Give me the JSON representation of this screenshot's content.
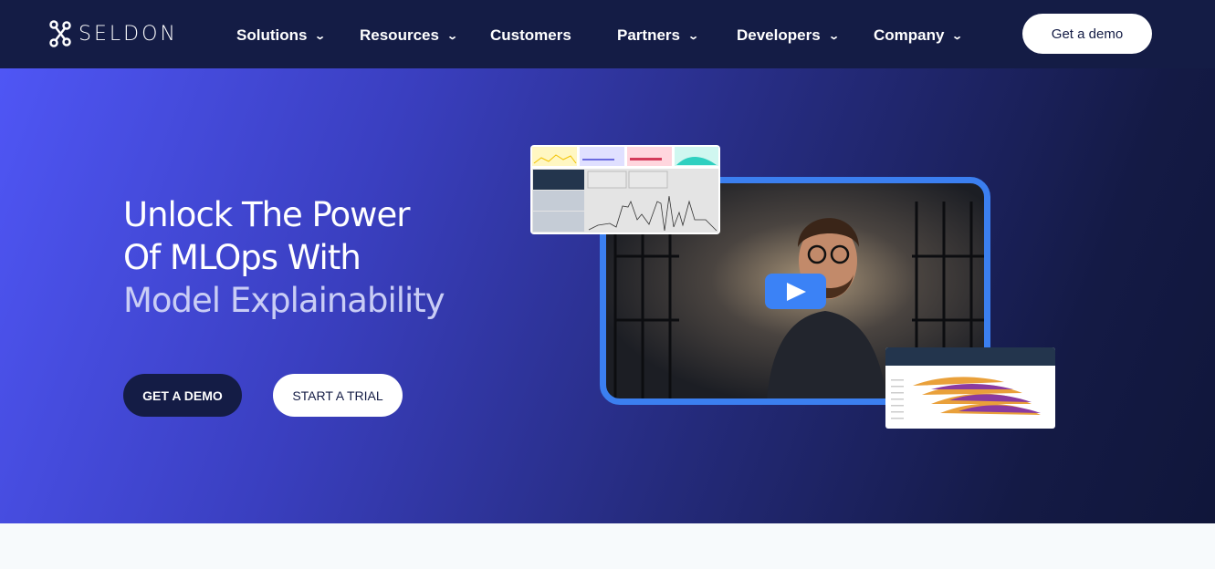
{
  "brand": {
    "name": "SELDON",
    "logo_icon": "seldon-knot-logo"
  },
  "nav": {
    "items": [
      {
        "label": "Solutions",
        "has_dropdown": true
      },
      {
        "label": "Resources",
        "has_dropdown": true
      },
      {
        "label": "Customers",
        "has_dropdown": false
      },
      {
        "label": "Partners",
        "has_dropdown": true
      },
      {
        "label": "Developers",
        "has_dropdown": true
      },
      {
        "label": "Company",
        "has_dropdown": true
      }
    ],
    "cta": "Get a demo"
  },
  "hero": {
    "line1": "Unlock The Power",
    "line2": "Of MLOps With",
    "line3": "Model Explainability",
    "primary_button": "GET A DEMO",
    "secondary_button": "START A TRIAL"
  },
  "colors": {
    "nav_bg": "#141c45",
    "accent": "#3b82f6",
    "hero_start": "#4f56f5"
  }
}
